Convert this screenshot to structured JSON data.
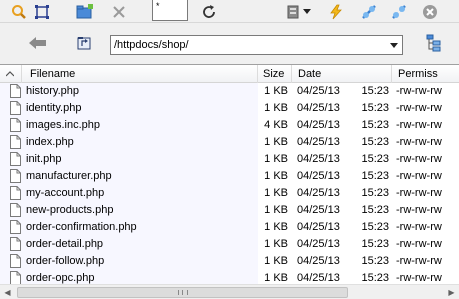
{
  "toolbar": {
    "filter_value": "*",
    "buttons": [
      "search-icon",
      "select-icon",
      "new-folder-icon",
      "delete-icon",
      "refresh-icon",
      "server-icon",
      "lightning-icon",
      "connect-icon",
      "disconnect-icon",
      "close-icon"
    ]
  },
  "location": {
    "path": "/httpdocs/shop/"
  },
  "columns": {
    "filename": "Filename",
    "size": "Size",
    "date": "Date",
    "permissions": "Permiss"
  },
  "files": [
    {
      "name": "history.php",
      "size": "1 KB",
      "date": "04/25/13",
      "time": "15:23",
      "perm": "-rw-rw-rw"
    },
    {
      "name": "identity.php",
      "size": "1 KB",
      "date": "04/25/13",
      "time": "15:23",
      "perm": "-rw-rw-rw"
    },
    {
      "name": "images.inc.php",
      "size": "4 KB",
      "date": "04/25/13",
      "time": "15:23",
      "perm": "-rw-rw-rw"
    },
    {
      "name": "index.php",
      "size": "1 KB",
      "date": "04/25/13",
      "time": "15:23",
      "perm": "-rw-rw-rw"
    },
    {
      "name": "init.php",
      "size": "1 KB",
      "date": "04/25/13",
      "time": "15:23",
      "perm": "-rw-rw-rw"
    },
    {
      "name": "manufacturer.php",
      "size": "1 KB",
      "date": "04/25/13",
      "time": "15:23",
      "perm": "-rw-rw-rw"
    },
    {
      "name": "my-account.php",
      "size": "1 KB",
      "date": "04/25/13",
      "time": "15:23",
      "perm": "-rw-rw-rw"
    },
    {
      "name": "new-products.php",
      "size": "1 KB",
      "date": "04/25/13",
      "time": "15:23",
      "perm": "-rw-rw-rw"
    },
    {
      "name": "order-confirmation.php",
      "size": "1 KB",
      "date": "04/25/13",
      "time": "15:23",
      "perm": "-rw-rw-rw"
    },
    {
      "name": "order-detail.php",
      "size": "1 KB",
      "date": "04/25/13",
      "time": "15:23",
      "perm": "-rw-rw-rw"
    },
    {
      "name": "order-follow.php",
      "size": "1 KB",
      "date": "04/25/13",
      "time": "15:23",
      "perm": "-rw-rw-rw"
    },
    {
      "name": "order-opc.php",
      "size": "1 KB",
      "date": "04/25/13",
      "time": "15:23",
      "perm": "-rw-rw-rw"
    }
  ],
  "colors": {
    "icon_orange": "#e8a020",
    "icon_blue": "#2a6fc0",
    "name_column_bg": "#f7f7ff"
  }
}
